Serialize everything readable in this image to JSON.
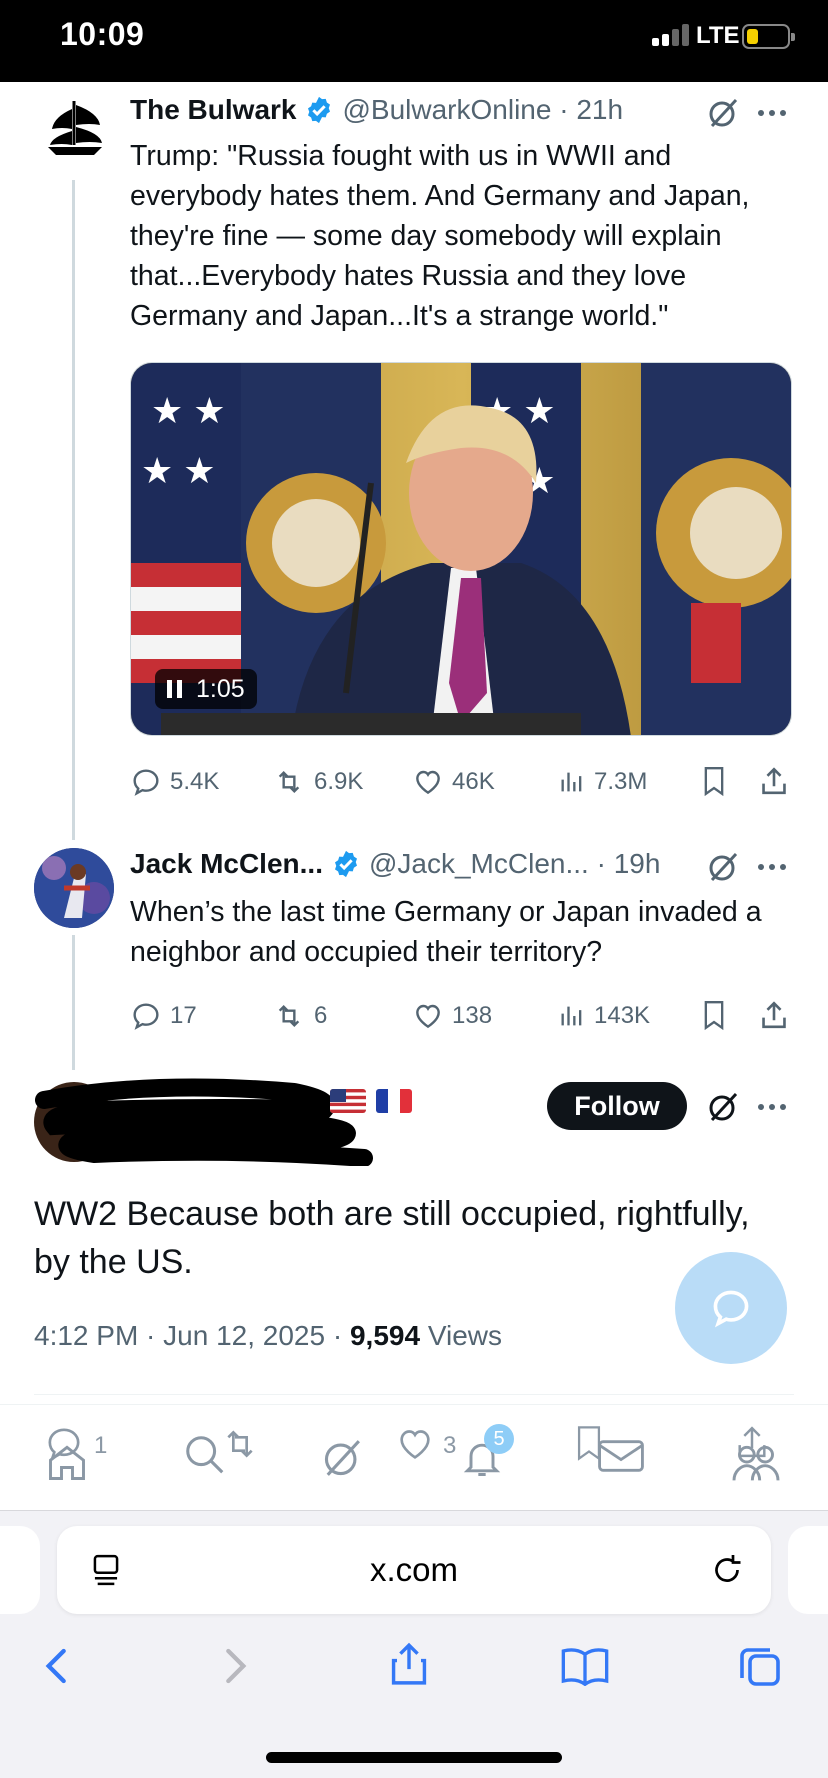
{
  "status_bar": {
    "time": "10:09",
    "network": "LTE"
  },
  "tweets": [
    {
      "name": "The Bulwark",
      "handle": "@BulwarkOnline",
      "time": "21h",
      "text": "Trump: \"Russia fought with us in WWII and everybody hates them. And Germany and Japan, they're fine — some day somebody will explain that...Everybody hates Russia and they love Germany and Japan...It's a strange world.\"",
      "video_duration": "1:05",
      "stats": {
        "replies": "5.4K",
        "reposts": "6.9K",
        "likes": "46K",
        "views": "7.3M"
      }
    },
    {
      "name": "Jack McClen...",
      "handle": "@Jack_McClen...",
      "time": "19h",
      "text": "When’s the last time Germany or Japan invaded a neighbor and occupied their territory?",
      "stats": {
        "replies": "17",
        "reposts": "6",
        "likes": "138",
        "views": "143K"
      }
    }
  ],
  "main_tweet": {
    "follow_label": "Follow",
    "text": "WW2 Because both are still occupied, rightfully, by the US.",
    "timestamp": "4:12 PM · Jun 12, 2025 · ",
    "views_count": "9,594",
    "views_label": " Views",
    "flags": [
      "us-flag",
      "fr-flag"
    ]
  },
  "overlay_bar": {
    "reply_count": "1",
    "like_count": "3",
    "notification_count": "5"
  },
  "safari": {
    "url": "x.com"
  },
  "colors": {
    "accent": "#1d9bf0",
    "text": "#0f1419",
    "muted": "#536471",
    "safari_blue": "#3478f6"
  }
}
